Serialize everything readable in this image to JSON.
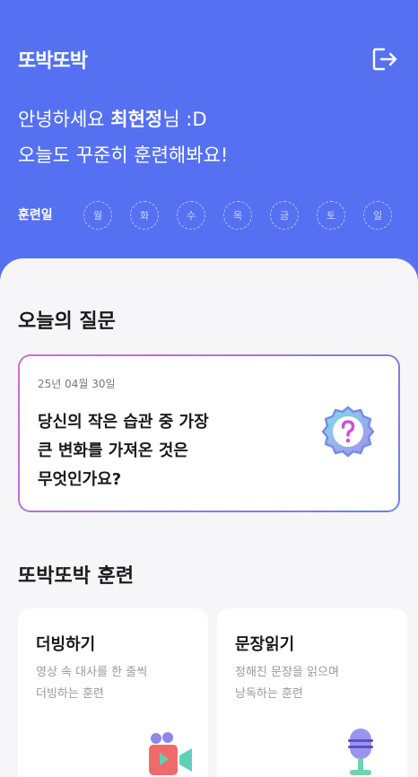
{
  "header": {
    "logo": "또박또박",
    "greeting_prefix": "안녕하세요 ",
    "user_name": "최현정",
    "greeting_suffix": "님 :D",
    "greeting_line2": "오늘도 꾸준히 훈련해봐요!",
    "training_days_label": "훈련일",
    "days": [
      "월",
      "화",
      "수",
      "목",
      "금",
      "토",
      "일"
    ],
    "logout_icon": "logout-icon"
  },
  "question": {
    "section_title": "오늘의 질문",
    "date": "25년 04월 30일",
    "lines": [
      "당신의 작은 습관 중 가장",
      "큰 변화를 가져온 것은",
      "무엇인가요?"
    ],
    "icon": "question-badge-icon"
  },
  "training": {
    "section_title": "또박또박 훈련",
    "cards": [
      {
        "title": "더빙하기",
        "desc": [
          "영상 속 대사를 한 줄씩",
          "더빙하는 훈련"
        ],
        "icon": "video-camera-icon"
      },
      {
        "title": "문장읽기",
        "desc": [
          "정해진 문장을 읽으며",
          "낭독하는 훈련"
        ],
        "icon": "microphone-icon"
      }
    ]
  },
  "colors": {
    "primary": "#5571f2",
    "background": "#f6f6f8",
    "card_border_start": "#d26ad8",
    "card_border_end": "#6a82e8"
  }
}
